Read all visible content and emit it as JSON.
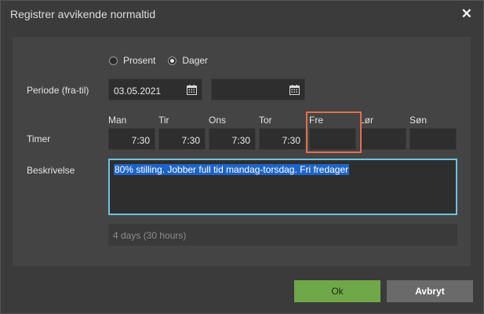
{
  "dialog": {
    "title": "Registrer avvikende normaltid",
    "close_glyph": "✕"
  },
  "mode": {
    "options": [
      {
        "label": "Prosent",
        "selected": false
      },
      {
        "label": "Dager",
        "selected": true
      }
    ]
  },
  "period": {
    "label": "Periode (fra-til)",
    "from_value": "03.05.2021",
    "to_value": "",
    "calendar_icon": "calendar-icon"
  },
  "hours": {
    "label": "Timer",
    "days": [
      {
        "name": "Man",
        "value": "7:30"
      },
      {
        "name": "Tir",
        "value": "7:30"
      },
      {
        "name": "Ons",
        "value": "7:30"
      },
      {
        "name": "Tor",
        "value": "7:30"
      },
      {
        "name": "Fre",
        "value": ""
      },
      {
        "name": "Lør",
        "value": ""
      },
      {
        "name": "Søn",
        "value": ""
      }
    ]
  },
  "description": {
    "label": "Beskrivelse",
    "value": "80% stilling. Jobber full tid mandag-torsdag. Fri fredager"
  },
  "summary": {
    "text": "4 days (30 hours)"
  },
  "buttons": {
    "ok_label": "Ok",
    "cancel_label": "Avbryt"
  },
  "colors": {
    "accent_ok": "#6fa848",
    "focus_border": "#6ec4e0",
    "selection": "#1e64c8",
    "highlight_box": "#e07050"
  }
}
